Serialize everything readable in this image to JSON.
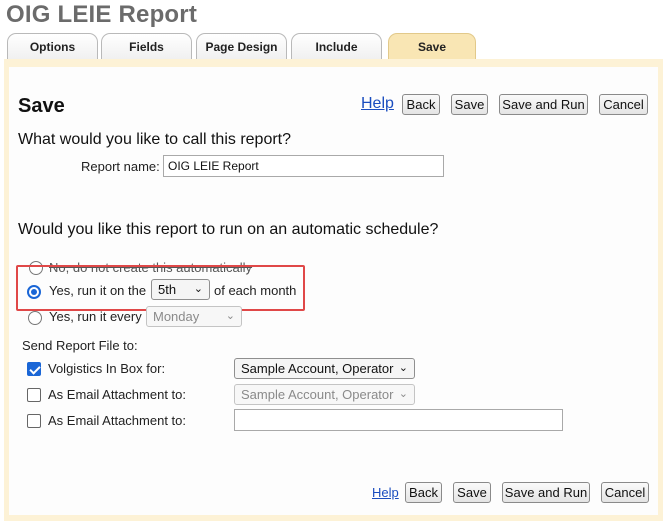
{
  "app": {
    "title": "OIG LEIE Report"
  },
  "tabs": [
    {
      "label": "Options"
    },
    {
      "label": "Fields"
    },
    {
      "label": "Page Design"
    },
    {
      "label": "Include"
    },
    {
      "label": "Save",
      "active": true
    }
  ],
  "page": {
    "title": "Save"
  },
  "toolbar": {
    "help": "Help",
    "back": "Back",
    "save": "Save",
    "save_run": "Save and Run",
    "cancel": "Cancel"
  },
  "name_section": {
    "question": "What would you like to call this report?",
    "label": "Report name:",
    "value": "OIG LEIE Report"
  },
  "schedule": {
    "question": "Would you like this report to run on an automatic schedule?",
    "option_no": "No, do not create this automatically",
    "option_monthly_prefix": "Yes, run it on the",
    "option_monthly_day": "5th",
    "option_monthly_suffix": "of each month",
    "option_weekly_prefix": "Yes, run it every",
    "option_weekly_day": "Monday",
    "selected": "monthly"
  },
  "send": {
    "heading": "Send Report File to:",
    "inbox_label": "Volgistics In Box for:",
    "inbox_checked": true,
    "inbox_value": "Sample Account, Operator",
    "email1_label": "As Email Attachment to:",
    "email1_checked": false,
    "email1_value": "Sample Account, Operator",
    "email2_label": "As Email Attachment to:",
    "email2_checked": false,
    "email2_value": ""
  },
  "colors": {
    "accent": "#1a66d6",
    "tab_active": "#f9e6b4",
    "panel": "#fdf2d6",
    "highlight": "#e04848",
    "link": "#1a4dbf"
  }
}
